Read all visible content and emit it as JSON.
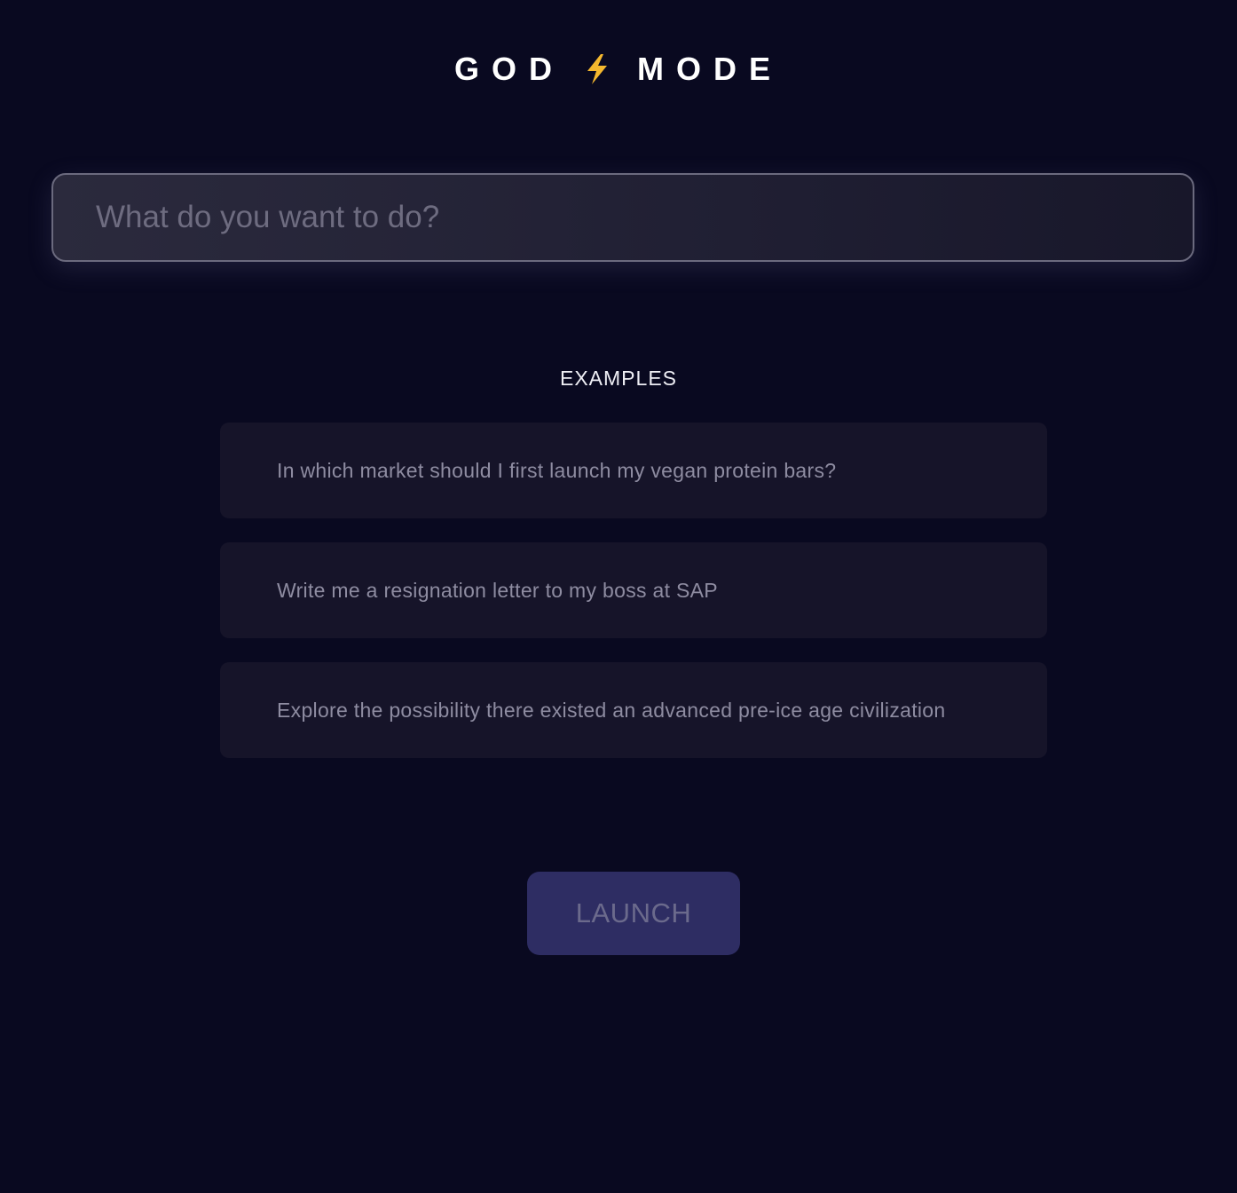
{
  "header": {
    "title_left": "GOD",
    "title_icon": "lightning-bolt-icon",
    "title_right": "MODE"
  },
  "search": {
    "placeholder": "What do you want to do?",
    "value": ""
  },
  "examples": {
    "heading": "EXAMPLES",
    "items": [
      {
        "text": "In which market should I first launch my vegan protein bars?"
      },
      {
        "text": "Write me a resignation letter to my boss at SAP"
      },
      {
        "text": "Explore the possibility there existed an advanced pre-ice age civilization"
      }
    ]
  },
  "launch": {
    "label": "LAUNCH"
  },
  "colors": {
    "background": "#090920",
    "card": "#161429",
    "button": "#2e2d63",
    "bolt": "#f5b82e"
  }
}
